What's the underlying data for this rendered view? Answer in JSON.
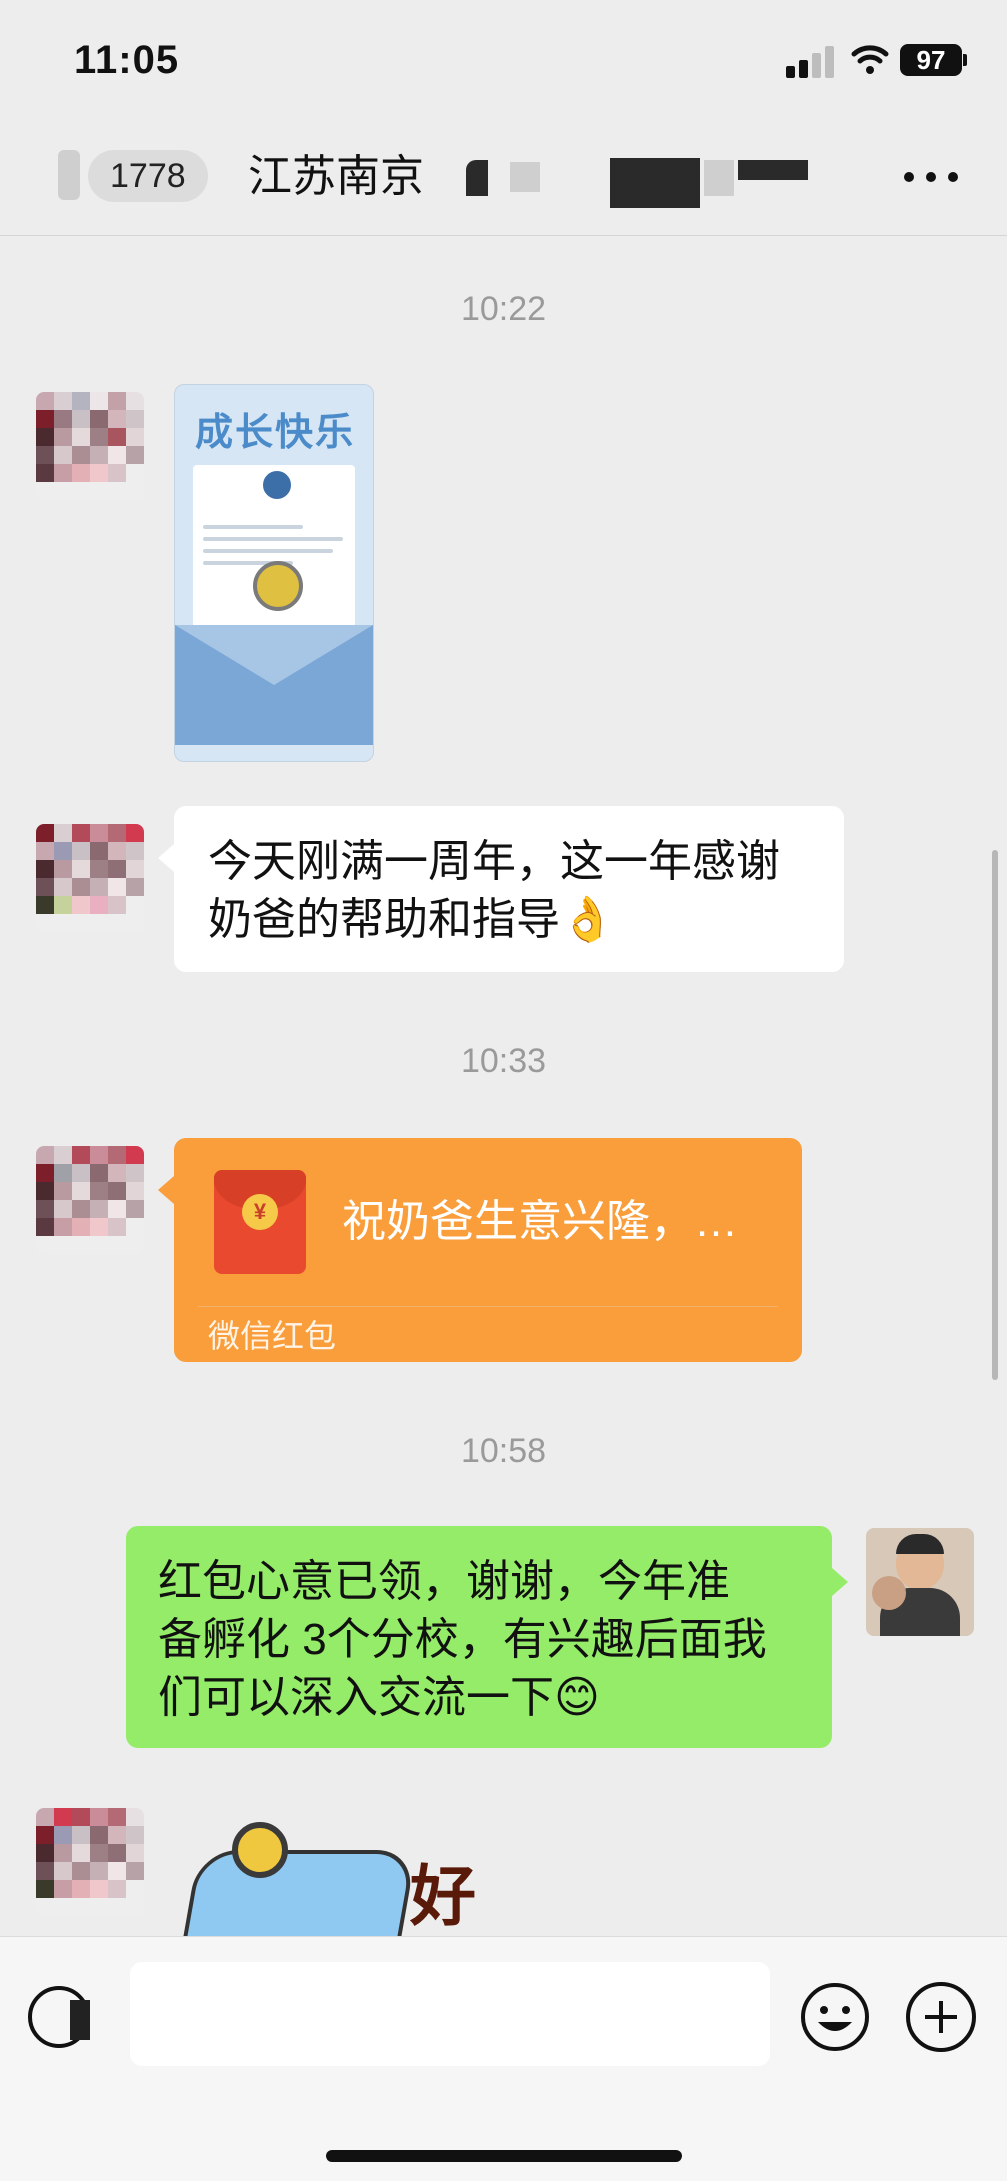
{
  "status_bar": {
    "time": "11:05",
    "battery": "97"
  },
  "nav": {
    "unread_count": "1778",
    "title": "江苏南京"
  },
  "messages": [
    {
      "timestamp": "10:22"
    },
    {
      "text_line1": "今天刚满一周年，这一年感谢",
      "text_line2": "奶爸的帮助和指导👌"
    },
    {
      "timestamp": "10:33"
    },
    {
      "packet_text": "祝奶爸生意兴隆，…",
      "packet_label": "微信红包",
      "coin": "¥"
    },
    {
      "timestamp": "10:58"
    },
    {
      "line1": "红包心意已领，谢谢，今年准",
      "line2": "备孵化 3个分校，有兴趣后面我",
      "line3": "们可以深入交流一下😊"
    }
  ],
  "card": {
    "title": "成长快乐"
  },
  "sticker": {
    "text": "好"
  },
  "colors": {
    "background": "#ededed",
    "green_bubble": "#95ec69",
    "red_packet": "#fa9d3b"
  }
}
